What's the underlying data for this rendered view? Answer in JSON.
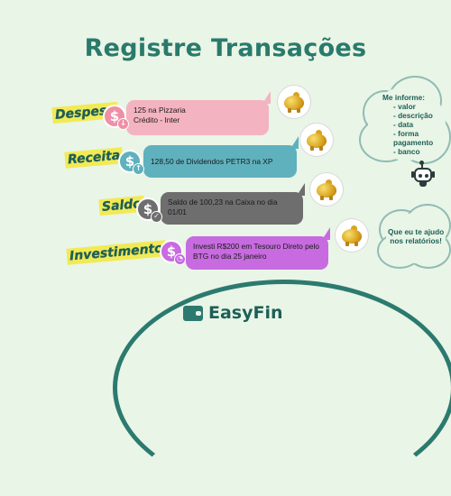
{
  "title": "Registre Transações",
  "colors": {
    "background": "#e9f5e6",
    "title": "#2a7a6c",
    "highlight": "#f2ea55",
    "despesa_bubble": "#f4b3c0",
    "despesa_coin": "#ef8fa6",
    "receita_bubble": "#5fb1be",
    "receita_coin": "#5fb1be",
    "saldo_bubble": "#6e6e6e",
    "saldo_coin": "#6e6e6e",
    "investimento_bubble": "#c86be0",
    "investimento_coin": "#c86be0"
  },
  "transactions": [
    {
      "label": "Despesa",
      "icon": "dollar-down-icon",
      "text_line1": "125 na Pizzaria",
      "text_line2": "Crédito - Inter"
    },
    {
      "label": "Receita",
      "icon": "dollar-up-icon",
      "text_line1": "128,50 de Dividendos PETR3 na XP",
      "text_line2": ""
    },
    {
      "label": "Saldo",
      "icon": "dollar-check-icon",
      "text_line1": "Saldo de 100,23 na Caixa no dia",
      "text_line2": "01/01"
    },
    {
      "label": "Investimento",
      "icon": "dollar-chart-icon",
      "text_line1": "Investi R$200 em Tesouro Direto pelo",
      "text_line2": "BTG no dia 25 janeiro"
    }
  ],
  "cloud_top": {
    "heading": "Me informe:",
    "items": [
      "valor",
      "descrição",
      "data",
      "forma pagamento",
      "banco"
    ]
  },
  "cloud_bottom": {
    "line1": "Que eu te ajudo",
    "line2": "nos relatórios!"
  },
  "brand": {
    "name": "EasyFin",
    "icon": "wallet-icon"
  },
  "decor": {
    "pig_icon": "golden-piggy-bank-icon",
    "robot_icon": "robot-icon"
  }
}
